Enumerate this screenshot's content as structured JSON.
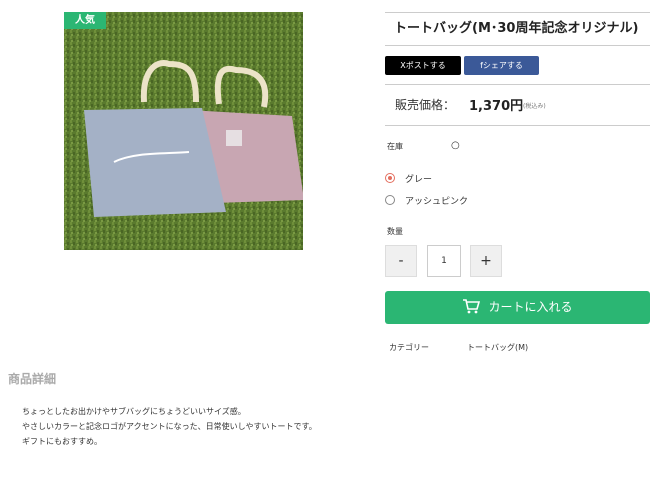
{
  "product": {
    "badge": "人気",
    "title": "トートバッグ(M･30周年記念オリジナル)",
    "image_icon": "product-photo-tote-bags"
  },
  "share": {
    "x_label": "Xポストする",
    "facebook_label": "fシェアする"
  },
  "price": {
    "label": "販売価格：",
    "value": "1,370円",
    "tax_note": "(税込み)"
  },
  "stock": {
    "label": "在庫",
    "value": "○"
  },
  "options": [
    {
      "label": "グレー",
      "selected": true
    },
    {
      "label": "アッシュピンク",
      "selected": false
    }
  ],
  "quantity": {
    "label": "数量",
    "minus": "-",
    "value": "1",
    "plus": "+"
  },
  "cart": {
    "label": "カートに入れる",
    "icon": "cart-icon"
  },
  "category": {
    "label": "カテゴリー",
    "value": "トートバッグ(M)"
  },
  "details": {
    "heading": "商品詳細",
    "lines": [
      "ちょっとしたお出かけやサブバッグにちょうどいいサイズ感。",
      "やさしいカラーと記念ロゴがアクセントになった、日常使いしやすいトートです。",
      "ギフトにもおすすめ。"
    ]
  },
  "colors": {
    "accent": "#2bb673",
    "radio_selected": "#e36e5e",
    "facebook": "#3b5998"
  }
}
